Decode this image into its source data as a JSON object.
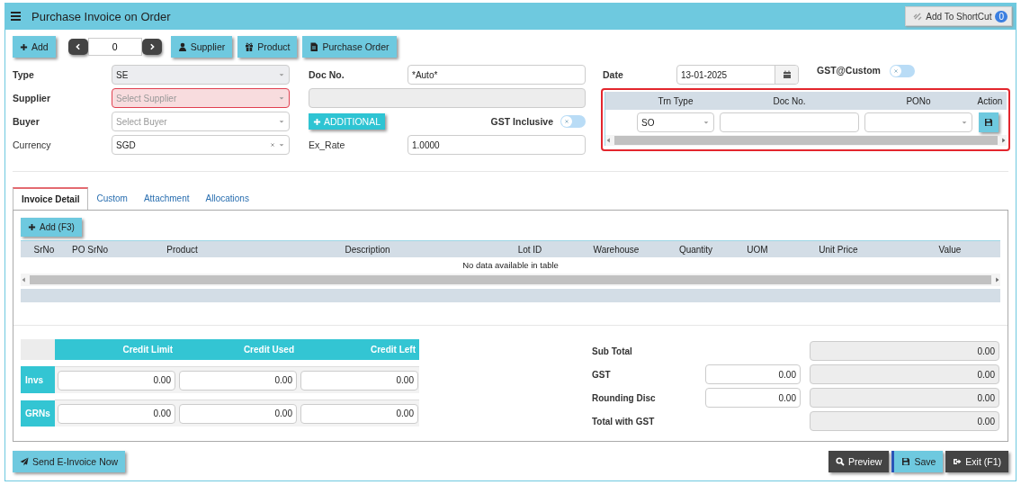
{
  "window": {
    "title": "Purchase Invoice on Order"
  },
  "shortcut": {
    "label": "Add To ShortCut",
    "count": "0"
  },
  "toolbar": {
    "add_label": "Add",
    "record": "0",
    "buttons": [
      {
        "kind": "supplier",
        "label": "Supplier"
      },
      {
        "kind": "product",
        "label": "Product"
      },
      {
        "kind": "order",
        "label": "Purchase Order"
      }
    ]
  },
  "left_fields": [
    {
      "label": "Type",
      "required": true,
      "value": "SE",
      "disabled": true,
      "invalid": false,
      "clearable": false
    },
    {
      "label": "Supplier",
      "required": true,
      "placeholder": "Select Supplier",
      "disabled": false,
      "invalid": true,
      "clearable": false
    },
    {
      "label": "Buyer",
      "required": true,
      "placeholder": "Select Buyer",
      "disabled": false,
      "invalid": false,
      "clearable": false
    },
    {
      "label": "Currency",
      "required": false,
      "value": "SGD",
      "disabled": false,
      "invalid": false,
      "clearable": true
    }
  ],
  "doc_no": {
    "label": "Doc No.",
    "required": true,
    "value": "*Auto*"
  },
  "name_field": {
    "disabled": true
  },
  "additional_button": "ADDITIONAL",
  "gst_inclusive": {
    "label": "GST Inclusive",
    "on": false
  },
  "ex_rate": {
    "label": "Ex_Rate",
    "required": false,
    "value": "1.0000"
  },
  "date": {
    "label": "Date",
    "value": "13-01-2025"
  },
  "gst_custom": {
    "label": "GST@Custom",
    "on": false
  },
  "reference_table": {
    "columns": [
      "Trn Type",
      "Doc No.",
      "PONo",
      "Action"
    ],
    "row": {
      "trn_type": "SO"
    }
  },
  "tabs": [
    {
      "label": "Invoice Detail",
      "selected": true
    },
    {
      "label": "Custom",
      "selected": false
    },
    {
      "label": "Attachment",
      "selected": false
    },
    {
      "label": "Allocations",
      "selected": false
    }
  ],
  "detail": {
    "add_label": "Add (F3)",
    "columns": [
      "SrNo",
      "PO SrNo",
      "Product",
      "Description",
      "Lot ID",
      "Warehouse",
      "Quantity",
      "UOM",
      "Unit Price",
      "Value"
    ],
    "empty_message": "No data available in table"
  },
  "credit": {
    "columns": [
      "Credit Limit",
      "Credit Used",
      "Credit Left"
    ],
    "rows": [
      {
        "label": "Invs",
        "values": [
          "0.00",
          "0.00",
          "0.00"
        ]
      },
      {
        "label": "GRNs",
        "values": [
          "0.00",
          "0.00",
          "0.00"
        ]
      }
    ]
  },
  "totals": [
    {
      "kind": "computed",
      "label": "Sub Total",
      "value": "0.00"
    },
    {
      "kind": "adjustable",
      "label": "GST",
      "input": "0.00",
      "value": "0.00"
    },
    {
      "kind": "adjustable",
      "label": "Rounding Disc",
      "input": "0.00",
      "value": "0.00"
    },
    {
      "kind": "computed",
      "label": "Total with GST",
      "value": "0.00"
    }
  ],
  "footer": {
    "send_label": "Send E-Invoice Now",
    "actions": [
      {
        "kind": "preview",
        "label": "Preview"
      },
      {
        "kind": "save",
        "label": "Save"
      },
      {
        "kind": "exit",
        "label": "Exit (F1)"
      }
    ]
  }
}
